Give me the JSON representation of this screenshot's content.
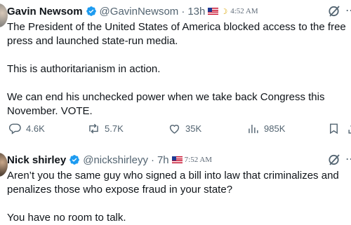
{
  "tweets": [
    {
      "author": "Gavin Newsom",
      "handle": "@GavinNewsom",
      "age": "13h",
      "ext_time": "4:52 AM",
      "body": "The President of the United States of America blocked access to the free press and launched state-run media.\n\nThis is authoritarianism in action.\n\nWe can end his unchecked power when we take back Congress this November. VOTE.",
      "replies": "4.6K",
      "reposts": "5.7K",
      "likes": "35K",
      "views": "985K"
    },
    {
      "author": "Nick shirley",
      "handle": "@nickshirleyy",
      "age": "7h",
      "ext_time": "7:52 AM",
      "body": "Aren’t you the same guy who signed a bill into law that criminalizes and penalizes those who expose fraud in your state?\n\nYou have no room to talk."
    }
  ],
  "separator": "·",
  "colors": {
    "verified": "#1d9bf0",
    "text": "#0f1419",
    "muted": "#536471"
  },
  "icons": [
    "verified-badge-icon",
    "us-flag-icon",
    "moon-icon",
    "grok-icon",
    "more-icon",
    "reply-icon",
    "repost-icon",
    "like-icon",
    "views-icon",
    "bookmark-icon",
    "share-icon"
  ]
}
